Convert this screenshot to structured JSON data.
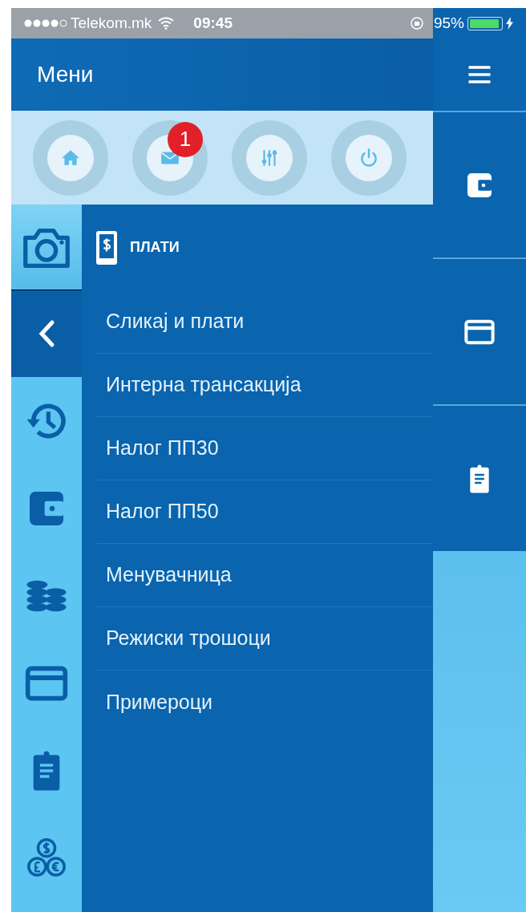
{
  "status_bar": {
    "carrier": "Telekom.mk",
    "time": "09:45",
    "battery": "95%"
  },
  "header": {
    "title": "Мени"
  },
  "quick_actions": [
    {
      "kind": "home"
    },
    {
      "kind": "mail",
      "badge": "1"
    },
    {
      "kind": "sliders"
    },
    {
      "kind": "power"
    }
  ],
  "rail": [
    {
      "kind": "camera",
      "selected": true
    },
    {
      "kind": "history",
      "selected": false
    },
    {
      "kind": "wallet",
      "selected": false
    },
    {
      "kind": "coins",
      "selected": false
    },
    {
      "kind": "card",
      "selected": false
    },
    {
      "kind": "clipboard",
      "selected": false
    },
    {
      "kind": "currencies",
      "selected": false
    }
  ],
  "submenu": {
    "title": "ПЛАТИ",
    "items": [
      "Сликај и плати",
      "Интерна трансакција",
      "Налог ПП30",
      "Налог ПП50",
      "Менувачница",
      "Режиски трошоци",
      "Примероци"
    ]
  },
  "side_tabs": [
    {
      "kind": "menu"
    },
    {
      "kind": "wallet"
    },
    {
      "kind": "card"
    },
    {
      "kind": "clipboard"
    }
  ]
}
